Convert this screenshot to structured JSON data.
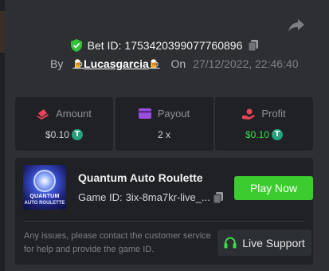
{
  "header": {
    "bet_id_label": "Bet ID:",
    "bet_id": "1753420399077760896",
    "by_label": "By",
    "username": "Lucasgarcia",
    "username_emoji": "🍺",
    "on_label": "On",
    "date": "27/12/2022, 22:46:40"
  },
  "stats": [
    {
      "label": "Amount",
      "value": "$0.10",
      "currency": "T",
      "value_color": "#cfd1d4"
    },
    {
      "label": "Payout",
      "value": "2 x",
      "currency": "",
      "value_color": "#cfd1d4"
    },
    {
      "label": "Profit",
      "value": "$0.10",
      "currency": "T",
      "value_color": "#3ddc4b"
    }
  ],
  "game": {
    "title": "Quantum Auto Roulette",
    "id_label": "Game ID:",
    "game_id": "3ix-8ma7kr-live_...",
    "thumb_line1": "QUANTUM",
    "thumb_line2": "AUTO ROULETTE",
    "play_label": "Play Now"
  },
  "support": {
    "help_text": "Any issues, please contact the customer service for help and provide the game ID.",
    "button_label": "Live Support"
  },
  "colors": {
    "background": "#2d2f32",
    "panel": "#1f2124",
    "accent_green": "#3dcc30",
    "profit_green": "#3ddc4b",
    "coin": "#26a17b"
  },
  "icons": {
    "share": "share-arrow-icon",
    "shield": "shield-check-icon",
    "copy": "copy-icon",
    "amount": "chip-icon",
    "payout": "wallet-card-icon",
    "profit": "hand-coin-icon",
    "support": "headset-icon",
    "currency": "tether-coin-icon"
  }
}
